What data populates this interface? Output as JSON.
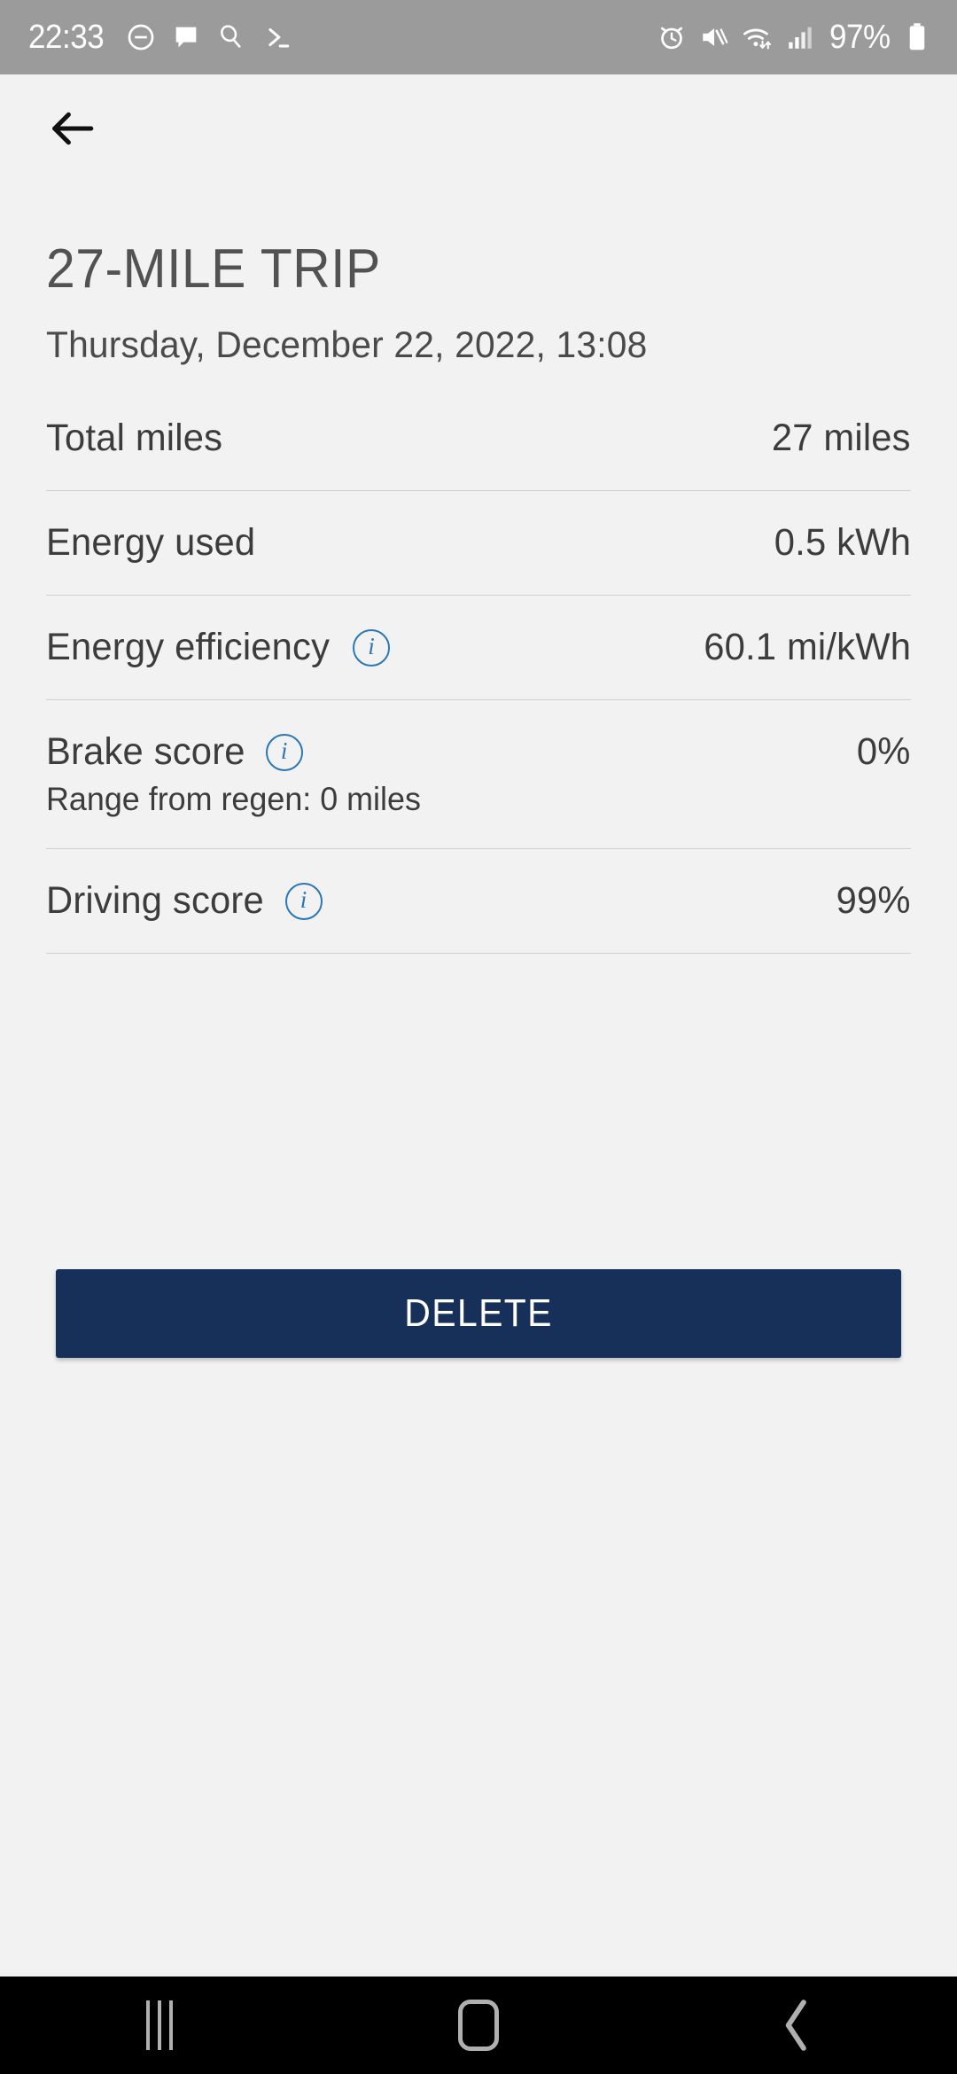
{
  "status_bar": {
    "time": "22:33",
    "battery_percent": "97%",
    "left_icons": [
      "do-not-disturb-icon",
      "message-bubble-icon",
      "magnifier-icon",
      "terminal-prompt-icon"
    ],
    "right_icons": [
      "alarm-clock-icon",
      "mute-vibrate-icon",
      "wifi-icon",
      "cellular-signal-icon",
      "battery-icon"
    ],
    "background_color": "#9b9b9b"
  },
  "appbar": {
    "back_icon": "back-arrow-icon"
  },
  "header": {
    "title": "27-MILE TRIP",
    "date": "Thursday, December 22, 2022, 13:08"
  },
  "rows": [
    {
      "label": "Total miles",
      "value": "27 miles",
      "has_info": false,
      "sub": null
    },
    {
      "label": "Energy used",
      "value": "0.5 kWh",
      "has_info": false,
      "sub": null
    },
    {
      "label": "Energy efficiency",
      "value": "60.1 mi/kWh",
      "has_info": true,
      "sub": null
    },
    {
      "label": "Brake score",
      "value": "0%",
      "has_info": true,
      "sub": "Range from regen: 0 miles"
    },
    {
      "label": "Driving score",
      "value": "99%",
      "has_info": true,
      "sub": null
    }
  ],
  "delete_button": {
    "label": "DELETE",
    "color": "#16305a"
  },
  "nav_bar": {
    "recents_label": "recents-icon",
    "home_label": "home-icon",
    "back_label": "back-icon"
  },
  "colors": {
    "page_background": "#f2f2f2",
    "info_icon": "#2b77b5",
    "text_primary": "#3c3c3c",
    "title": "#525252",
    "divider": "#d0d0d0"
  },
  "info_glyph": "i"
}
